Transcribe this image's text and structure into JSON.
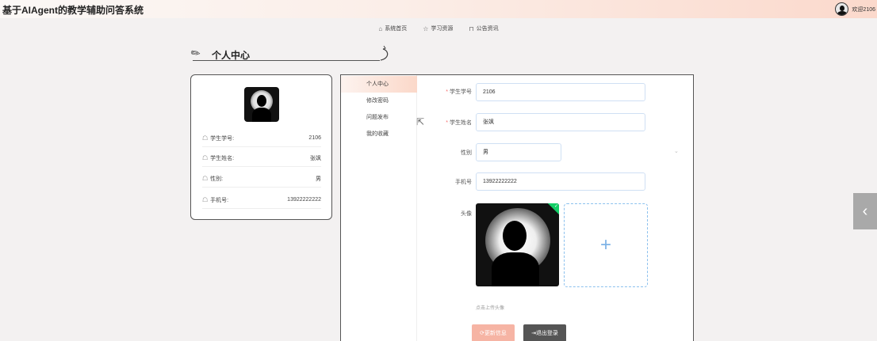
{
  "header": {
    "app_title": "基于AIAgent的教学辅助问答系统",
    "welcome_text": "欢迎2106"
  },
  "nav": {
    "items": [
      {
        "label": "系统首页",
        "icon": "home-icon"
      },
      {
        "label": "学习资源",
        "icon": "star-icon"
      },
      {
        "label": "公告资讯",
        "icon": "bag-icon"
      }
    ]
  },
  "page": {
    "title": "个人中心"
  },
  "profile": {
    "rows": [
      {
        "label": "学生学号:",
        "value": "2106"
      },
      {
        "label": "学生姓名:",
        "value": "张飒"
      },
      {
        "label": "性别:",
        "value": "男"
      },
      {
        "label": "手机号:",
        "value": "13922222222"
      }
    ]
  },
  "menu": {
    "items": [
      "个人中心",
      "修改密码",
      "问题发布",
      "我的收藏"
    ],
    "active_index": 0
  },
  "form": {
    "student_id_label": "学生学号",
    "student_id_value": "2106",
    "student_name_label": "学生姓名",
    "student_name_value": "张飒",
    "gender_label": "性别",
    "gender_value": "男",
    "phone_label": "手机号",
    "phone_value": "13922222222",
    "avatar_label": "头像",
    "upload_plus": "+",
    "upload_hint": "点击上传头像",
    "update_button": "更新信息",
    "logout_button": "退出登录"
  },
  "colors": {
    "accent": "#f6b4a4",
    "upload_border": "#8cc1ee",
    "success": "#13ce66",
    "logout_bg": "#555555"
  }
}
